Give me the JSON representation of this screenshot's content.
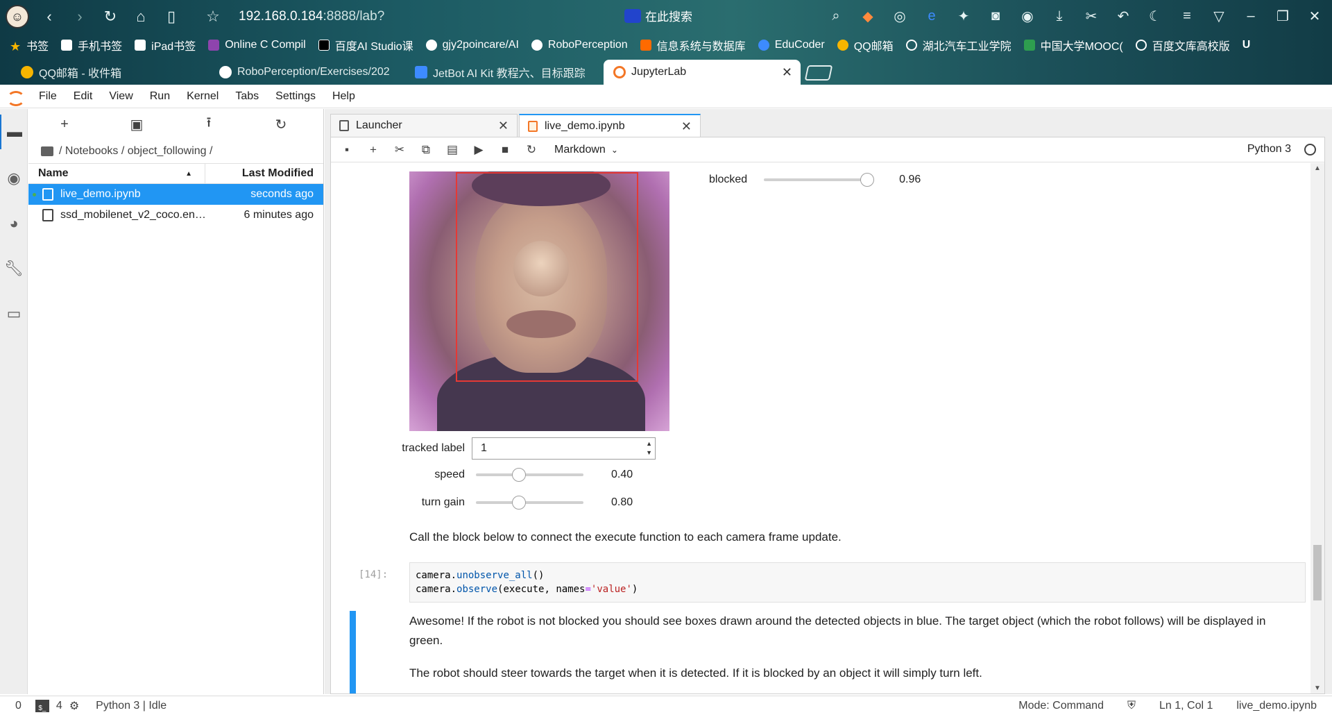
{
  "browser": {
    "url_host": "192.168.0.184",
    "url_rest": ":8888/lab?",
    "search_label": "在此搜索",
    "bookmarks": [
      "书签",
      "手机书签",
      "iPad书签",
      "Online C Compil",
      "百度AI Studio课",
      "gjy2poincare/AI",
      "RoboPerception",
      "信息系统与数据库",
      "EduCoder",
      "QQ邮箱",
      "湖北汽车工业学院",
      "中国大学MOOC(",
      "百度文库高校版",
      "U"
    ],
    "tabs": [
      {
        "label": "QQ邮箱 - 收件箱"
      },
      {
        "label": "RoboPerception/Exercises/202"
      },
      {
        "label": "JetBot AI Kit 教程六、目标跟踪"
      },
      {
        "label": "JupyterLab"
      }
    ]
  },
  "menu": [
    "File",
    "Edit",
    "View",
    "Run",
    "Kernel",
    "Tabs",
    "Settings",
    "Help"
  ],
  "file_browser": {
    "path": "/ Notebooks / object_following /",
    "col_name": "Name",
    "col_modified": "Last Modified",
    "files": [
      {
        "name": "live_demo.ipynb",
        "modified": "seconds ago",
        "selected": true
      },
      {
        "name": "ssd_mobilenet_v2_coco.eng...",
        "modified": "6 minutes ago",
        "selected": false
      }
    ]
  },
  "doc_tabs": {
    "launcher": "Launcher",
    "notebook": "live_demo.ipynb"
  },
  "notebook_toolbar": {
    "cell_type": "Markdown",
    "kernel": "Python 3"
  },
  "widgets": {
    "blocked_label": "blocked",
    "blocked_value": "0.96",
    "blocked_level": 0.96,
    "tracked_label": "tracked label",
    "tracked_value": "1",
    "speed_label": "speed",
    "speed_value": "0.40",
    "speed_level": 0.4,
    "turn_gain_label": "turn gain",
    "turn_gain_value": "0.80",
    "turn_gain_level": 0.4
  },
  "cells": {
    "md1": "Call the block below to connect the execute function to each camera frame update.",
    "code_prompt": "[14]:",
    "code_line1_obj": "camera",
    "code_line1_fn": "unobserve_all",
    "code_line1_end": "()",
    "code_line2_obj": "camera",
    "code_line2_fn": "observe",
    "code_line2_args": "(execute, names",
    "code_line2_eq": "=",
    "code_line2_str": "'value'",
    "code_line2_end": ")",
    "md2": "Awesome! If the robot is not blocked you should see boxes drawn around the detected objects in blue. The target object (which the robot follows) will be displayed in green.",
    "md3": "The robot should steer towards the target when it is detected. If it is blocked by an object it will simply turn left."
  },
  "status": {
    "count0": "0",
    "count1": "4",
    "kernel_state": "Python 3 | Idle",
    "mode": "Mode: Command",
    "position": "Ln 1, Col 1",
    "filename": "live_demo.ipynb"
  }
}
